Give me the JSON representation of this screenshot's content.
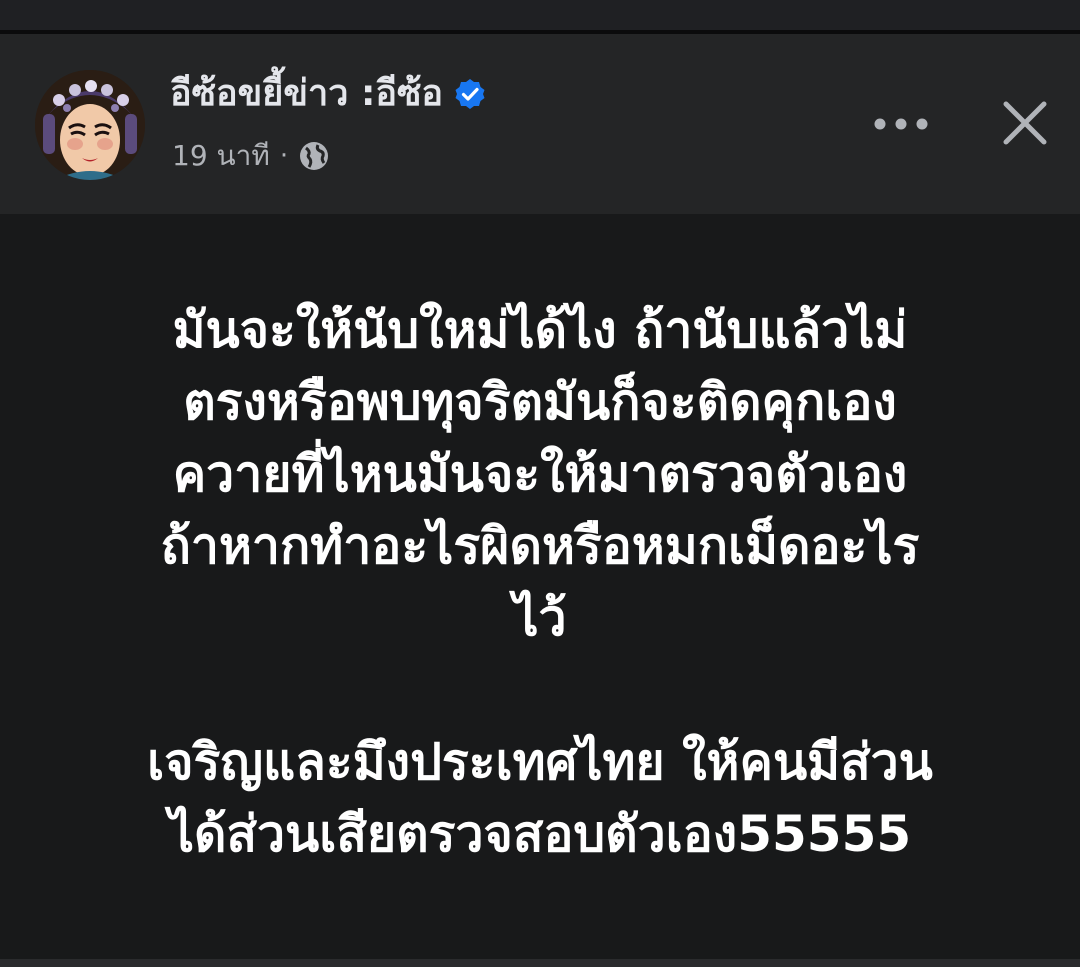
{
  "post": {
    "author_name": "อีซ้อขยี้ข่าว :อีซ้อ",
    "verified_icon": "verified-badge-icon",
    "time": "19 นาที",
    "separator": "·",
    "privacy_icon": "globe-icon",
    "lines": [
      "มันจะให้นับใหม่ได้ไง ถ้านับแล้วไม่",
      "ตรงหรือพบทุจริตมันก็จะติดคุกเอง",
      "ควายที่ไหนมันจะให้มาตรวจตัวเอง",
      "ถ้าหากทำอะไรผิดหรือหมกเม็ดอะไร",
      "ไว้",
      "",
      "เจริญและมึงประเทศไทย ให้คนมีส่วน",
      "ได้ส่วนเสียตรวจสอบตัวเอง55555"
    ]
  },
  "colors": {
    "header_bg": "#242526",
    "body_bg": "#18191a",
    "name_text": "#e4e6eb",
    "meta_text": "#b0b3b8",
    "verified": "#1877f2",
    "post_text": "#ffffff"
  },
  "icons": {
    "more": "more-horizontal-icon",
    "close": "close-icon"
  }
}
